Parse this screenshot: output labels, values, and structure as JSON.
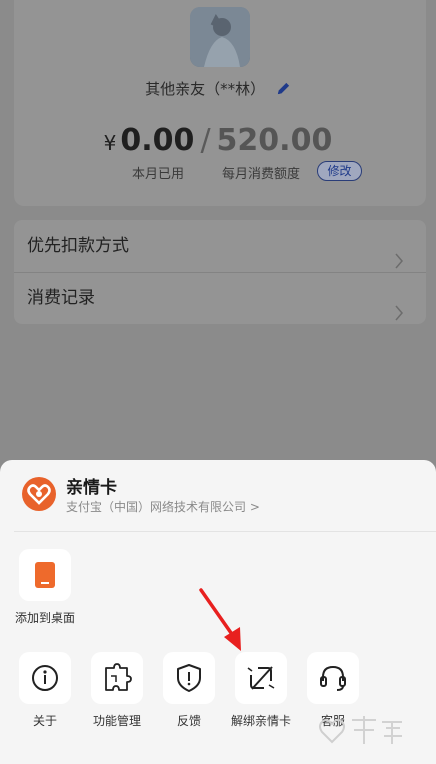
{
  "card": {
    "friend_name": "其他亲友（**林）",
    "currency": "¥",
    "used_amount": "0.00",
    "separator": "/",
    "monthly_limit": "520.00",
    "used_label": "本月已用",
    "limit_label": "每月消费额度",
    "modify_label": "修改"
  },
  "menu": {
    "items": [
      {
        "label": "优先扣款方式"
      },
      {
        "label": "消费记录"
      }
    ]
  },
  "sheet": {
    "app_name": "亲情卡",
    "company": "支付宝（中国）网络技术有限公司 >",
    "row1": [
      {
        "label": "添加到桌面",
        "icon": "add-to-desktop-icon"
      }
    ],
    "row2": [
      {
        "label": "关于",
        "icon": "info-icon"
      },
      {
        "label": "功能管理",
        "icon": "puzzle-icon"
      },
      {
        "label": "反馈",
        "icon": "shield-alert-icon"
      },
      {
        "label": "解绑亲情卡",
        "icon": "unlink-icon"
      },
      {
        "label": "客服",
        "icon": "headset-icon"
      }
    ]
  },
  "colors": {
    "brand_orange": "#e8622b",
    "accent_blue": "#1f3a8a",
    "annotation_red": "#e8201f"
  }
}
